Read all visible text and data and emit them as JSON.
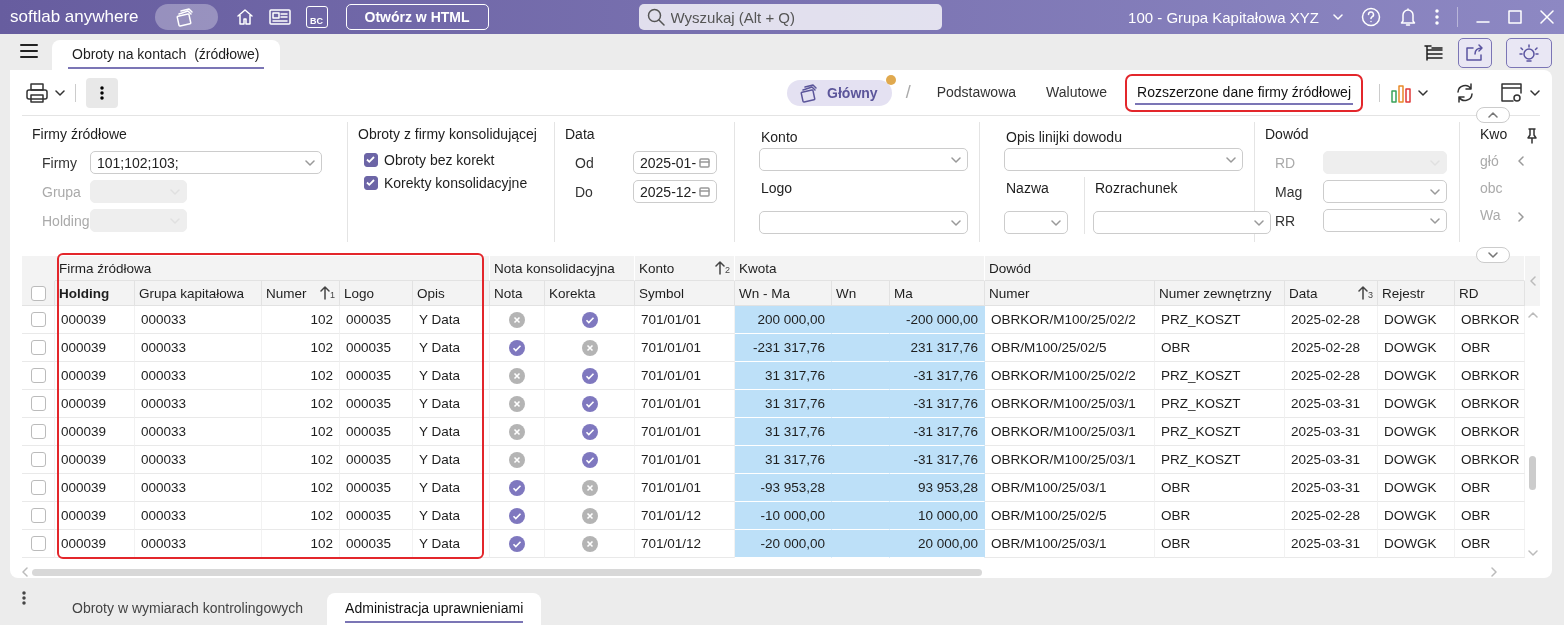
{
  "header": {
    "brand": "softlab anywhere",
    "badge_text": "BC",
    "open_button": "Otwórz w HTML",
    "search": {
      "placeholder": "Wyszukaj (Alt + Q)"
    },
    "company": "100 - Grupa Kapitałowa XYZ"
  },
  "document_tabs": [
    {
      "label": "Obroty na kontach  (źródłowe)",
      "selected": true
    }
  ],
  "views": {
    "main": {
      "label": "Główny",
      "modified": true
    },
    "separator": "/",
    "tabs": [
      {
        "label": "Podstawowa",
        "selected": false,
        "highlighted": false
      },
      {
        "label": "Walutowe",
        "selected": false,
        "highlighted": false
      },
      {
        "label": "Rozszerzone dane firmy źródłowej",
        "selected": true,
        "highlighted": true
      }
    ]
  },
  "filters": [
    {
      "kind": "rows",
      "title": "Firmy źródłowe",
      "fields": [
        {
          "label": "Firmy",
          "kind": "select",
          "value": "101;102;103;",
          "disabled": false
        },
        {
          "label": "Grupa",
          "kind": "select",
          "disabled": true
        },
        {
          "label": "Holding",
          "kind": "select",
          "disabled": true
        }
      ]
    },
    {
      "kind": "checks",
      "title": "Obroty z firmy konsolidującej",
      "options": [
        {
          "label": "Obroty bez korekt",
          "checked": true
        },
        {
          "label": "Korekty konsolidacyjne",
          "checked": true
        }
      ]
    },
    {
      "kind": "rows",
      "title": "Data",
      "fields": [
        {
          "label": "Od",
          "kind": "date",
          "value": "2025-01-",
          "disabled": false
        },
        {
          "label": "Do",
          "kind": "date",
          "value": "2025-12-",
          "disabled": false
        }
      ]
    },
    {
      "kind": "stacked",
      "rows": [
        {
          "fields": [
            {
              "label": "Konto",
              "kind": "select",
              "disabled": false
            }
          ]
        },
        {
          "fields": [
            {
              "label": "Logo",
              "kind": "select",
              "disabled": false
            }
          ]
        }
      ]
    },
    {
      "kind": "stacked",
      "rows": [
        {
          "fields": [
            {
              "label": "Opis linijki dowodu",
              "kind": "select",
              "disabled": false
            }
          ]
        },
        {
          "fields": [
            {
              "label": "Nazwa",
              "kind": "select",
              "disabled": false
            },
            {
              "label": "Rozrachunek",
              "kind": "select",
              "disabled": false
            }
          ]
        }
      ]
    },
    {
      "kind": "rows",
      "title": "Dowód",
      "fields": [
        {
          "label": "RD",
          "kind": "select",
          "disabled": true
        },
        {
          "label": "Mag",
          "kind": "select",
          "disabled": false
        },
        {
          "label": "RR",
          "kind": "select",
          "disabled": false
        }
      ]
    },
    {
      "kind": "cut",
      "title": "Kwo",
      "items": [
        "głó",
        "obc",
        "Wa"
      ]
    }
  ],
  "grid": {
    "groups": [
      {
        "label": "Firma źródłowa",
        "highlighted": true
      },
      {
        "label": "Nota konsolidacyjna",
        "highlighted": false
      },
      {
        "label": "Konto",
        "sort": "2",
        "highlighted": false
      },
      {
        "label": "Kwota",
        "highlighted": false
      },
      {
        "label": "Dowód",
        "highlighted": false
      }
    ],
    "columns": [
      {
        "label": "Holding",
        "kind": "text",
        "emphasis": true,
        "selected": false
      },
      {
        "label": "Grupa kapitałowa",
        "kind": "text",
        "emphasis": false,
        "selected": false
      },
      {
        "label": "Numer",
        "kind": "number",
        "sort": "1",
        "emphasis": false,
        "selected": false
      },
      {
        "label": "Logo",
        "kind": "text",
        "emphasis": false,
        "selected": false
      },
      {
        "label": "Opis",
        "kind": "text",
        "emphasis": false,
        "selected": false
      },
      {
        "label": "Nota",
        "kind": "flag",
        "emphasis": false,
        "selected": false
      },
      {
        "label": "Korekta",
        "kind": "flag",
        "emphasis": false,
        "selected": false
      },
      {
        "label": "Symbol",
        "kind": "text",
        "emphasis": false,
        "selected": false
      },
      {
        "label": "Wn - Ma",
        "kind": "number",
        "emphasis": false,
        "selected": true
      },
      {
        "label": "Wn",
        "kind": "number",
        "emphasis": false,
        "selected": true
      },
      {
        "label": "Ma",
        "kind": "number",
        "emphasis": false,
        "selected": true
      },
      {
        "label": "Numer",
        "kind": "text",
        "emphasis": false,
        "selected": false
      },
      {
        "label": "Numer zewnętrzny",
        "kind": "text",
        "emphasis": false,
        "selected": false
      },
      {
        "label": "Data",
        "kind": "text",
        "sort": "3",
        "emphasis": false,
        "selected": false
      },
      {
        "label": "Rejestr",
        "kind": "text",
        "emphasis": false,
        "selected": false
      },
      {
        "label": "RD",
        "kind": "text",
        "emphasis": false,
        "selected": false
      }
    ],
    "header_checked": false,
    "rows": [
      {
        "checked": false,
        "holding": "000039",
        "group": "000033",
        "number": "102",
        "logo": "000035",
        "description": "Y Data",
        "note": false,
        "correction": true,
        "symbol": "701/01/01",
        "wn_ma": "200 000,00",
        "ma": "-200 000,00",
        "doc_number": "OBRKOR/M100/25/02/2",
        "external_number": "PRZ_KOSZT",
        "date": "2025-02-28",
        "register": "DOWGK",
        "rd": "OBRKOR"
      },
      {
        "checked": false,
        "holding": "000039",
        "group": "000033",
        "number": "102",
        "logo": "000035",
        "description": "Y Data",
        "note": true,
        "correction": false,
        "symbol": "701/01/01",
        "wn_ma": "-231 317,76",
        "ma": "231 317,76",
        "doc_number": "OBR/M100/25/02/5",
        "external_number": "OBR",
        "date": "2025-02-28",
        "register": "DOWGK",
        "rd": "OBR"
      },
      {
        "checked": false,
        "holding": "000039",
        "group": "000033",
        "number": "102",
        "logo": "000035",
        "description": "Y Data",
        "note": false,
        "correction": true,
        "symbol": "701/01/01",
        "wn_ma": "31 317,76",
        "ma": "-31 317,76",
        "doc_number": "OBRKOR/M100/25/02/2",
        "external_number": "PRZ_KOSZT",
        "date": "2025-02-28",
        "register": "DOWGK",
        "rd": "OBRKOR"
      },
      {
        "checked": false,
        "holding": "000039",
        "group": "000033",
        "number": "102",
        "logo": "000035",
        "description": "Y Data",
        "note": false,
        "correction": true,
        "symbol": "701/01/01",
        "wn_ma": "31 317,76",
        "ma": "-31 317,76",
        "doc_number": "OBRKOR/M100/25/03/1",
        "external_number": "PRZ_KOSZT",
        "date": "2025-03-31",
        "register": "DOWGK",
        "rd": "OBRKOR"
      },
      {
        "checked": false,
        "holding": "000039",
        "group": "000033",
        "number": "102",
        "logo": "000035",
        "description": "Y Data",
        "note": false,
        "correction": true,
        "symbol": "701/01/01",
        "wn_ma": "31 317,76",
        "ma": "-31 317,76",
        "doc_number": "OBRKOR/M100/25/03/1",
        "external_number": "PRZ_KOSZT",
        "date": "2025-03-31",
        "register": "DOWGK",
        "rd": "OBRKOR"
      },
      {
        "checked": false,
        "holding": "000039",
        "group": "000033",
        "number": "102",
        "logo": "000035",
        "description": "Y Data",
        "note": false,
        "correction": true,
        "symbol": "701/01/01",
        "wn_ma": "31 317,76",
        "ma": "-31 317,76",
        "doc_number": "OBRKOR/M100/25/03/1",
        "external_number": "PRZ_KOSZT",
        "date": "2025-03-31",
        "register": "DOWGK",
        "rd": "OBRKOR"
      },
      {
        "checked": false,
        "holding": "000039",
        "group": "000033",
        "number": "102",
        "logo": "000035",
        "description": "Y Data",
        "note": true,
        "correction": false,
        "symbol": "701/01/01",
        "wn_ma": "-93 953,28",
        "ma": "93 953,28",
        "doc_number": "OBR/M100/25/03/1",
        "external_number": "OBR",
        "date": "2025-03-31",
        "register": "DOWGK",
        "rd": "OBR"
      },
      {
        "checked": false,
        "holding": "000039",
        "group": "000033",
        "number": "102",
        "logo": "000035",
        "description": "Y Data",
        "note": true,
        "correction": false,
        "symbol": "701/01/12",
        "wn_ma": "-10 000,00",
        "ma": "10 000,00",
        "doc_number": "OBR/M100/25/02/5",
        "external_number": "OBR",
        "date": "2025-02-28",
        "register": "DOWGK",
        "rd": "OBR"
      },
      {
        "checked": false,
        "holding": "000039",
        "group": "000033",
        "number": "102",
        "logo": "000035",
        "description": "Y Data",
        "note": true,
        "correction": false,
        "symbol": "701/01/12",
        "wn_ma": "-20 000,00",
        "ma": "20 000,00",
        "doc_number": "OBR/M100/25/03/1",
        "external_number": "OBR",
        "date": "2025-03-31",
        "register": "DOWGK",
        "rd": "OBR"
      }
    ]
  },
  "bottom_tabs": [
    {
      "label": "Obroty w wymiarach kontrolingowych",
      "selected": false
    },
    {
      "label": "Administracja uprawnieniami",
      "selected": true
    }
  ]
}
